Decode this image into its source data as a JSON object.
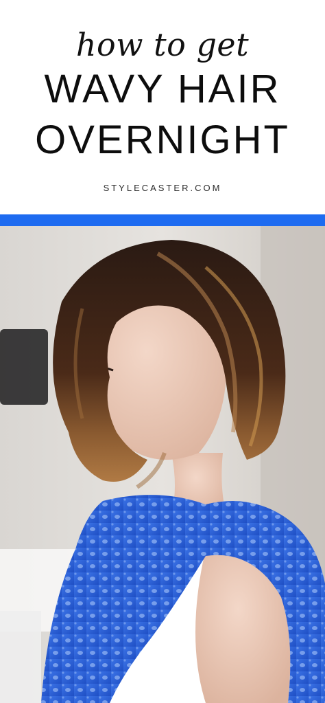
{
  "header": {
    "kicker": "how to get",
    "headline_line1": "WAVY HAIR",
    "headline_line2": "OVERNIGHT",
    "brand": "STYLECASTER.COM"
  },
  "colors": {
    "accent_rule": "#1e6bf0",
    "background": "#ffffff",
    "top_blue": "#2f6be0"
  }
}
